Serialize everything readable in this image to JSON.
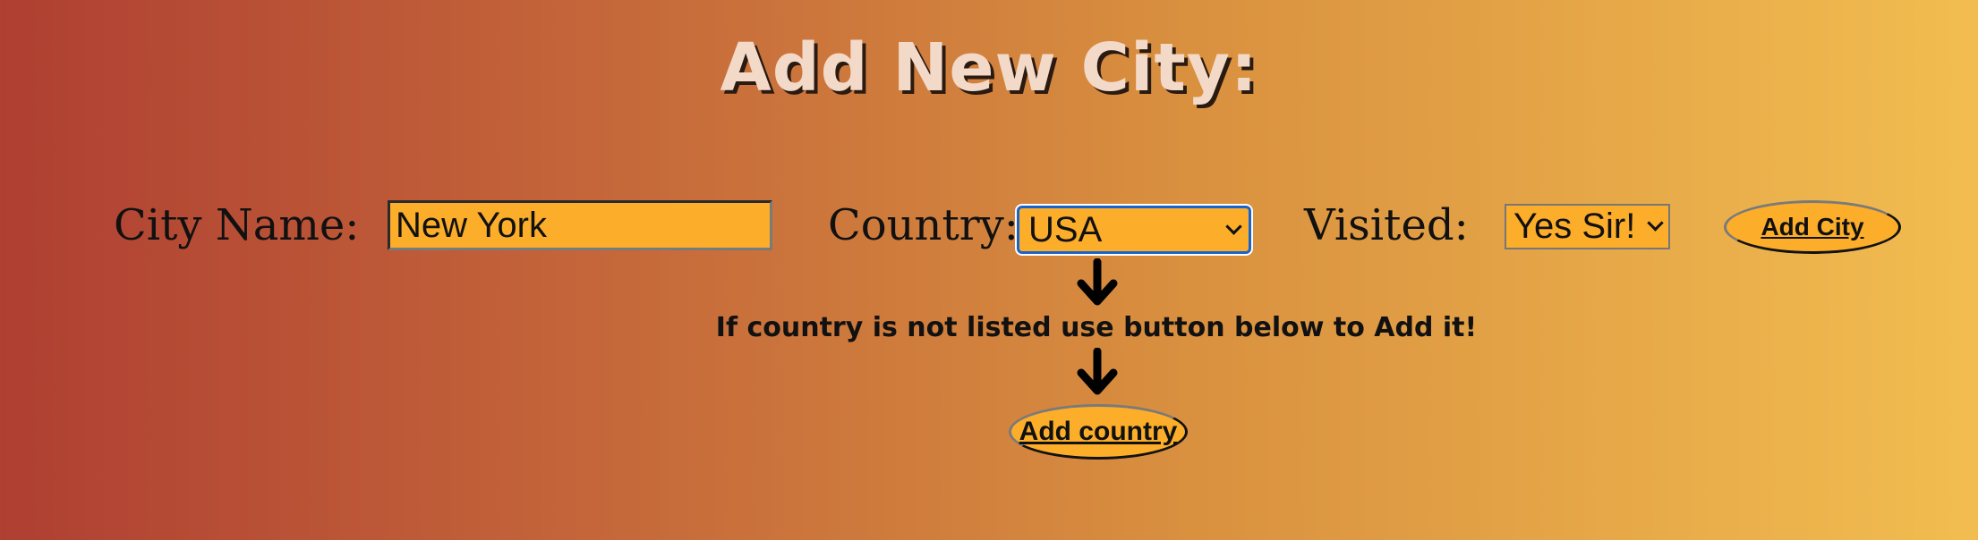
{
  "page": {
    "title": "Add New City:"
  },
  "form": {
    "city_label": "City Name:",
    "city_value": "New York",
    "country_label": "Country:",
    "country_selected": "USA",
    "visited_label": "Visited:",
    "visited_selected": "Yes Sir!",
    "add_city_label": "Add City"
  },
  "hint": {
    "text": "If country is not listed use button below to Add it!",
    "add_country_label": "Add country"
  },
  "colors": {
    "field_background": "#fcad2a",
    "gradient_start": "#af3f32",
    "gradient_end": "#f2bd50",
    "title_color": "#f3d9c8",
    "focus_border": "#1a63c9"
  },
  "icons": {
    "down_arrow": "down-arrow-icon",
    "select_chevron": "chevron-down-icon"
  }
}
